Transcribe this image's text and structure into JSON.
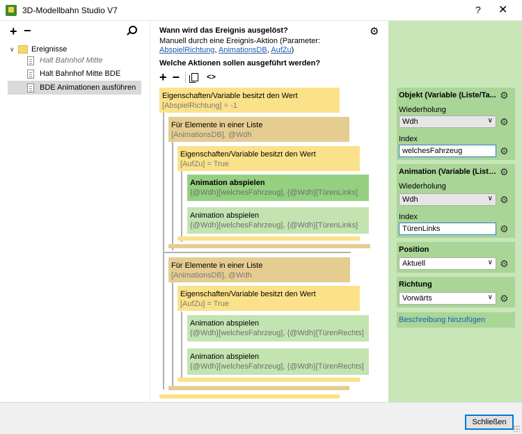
{
  "window": {
    "title": "3D-Modellbahn Studio V7",
    "help_glyph": "?",
    "close_glyph": "✕"
  },
  "left": {
    "add_glyph": "+",
    "remove_glyph": "−",
    "root": {
      "chevron": "∨",
      "label": "Ereignisse"
    },
    "items": [
      {
        "label": "Halt Bahnhof Mitte",
        "disabled": true
      },
      {
        "label": "Halt Bahnhof Mitte BDE"
      },
      {
        "label": "BDE Animationen ausführen",
        "selected": true
      }
    ]
  },
  "center": {
    "trigger_title": "Wann wird das Ereignis ausgelöst?",
    "trigger_gear": "⚙",
    "trigger_desc_prefix": "Manuell durch eine Ereignis-Aktion (Parameter: ",
    "trigger_link1": "AbspielRichtung",
    "trigger_sep1": ", ",
    "trigger_link2": "AnimationsDB",
    "trigger_sep2": ", ",
    "trigger_link3": "AufZu",
    "trigger_desc_suffix": ")",
    "actions_title": "Welche Aktionen sollen ausgeführt werden?",
    "toolbar": {
      "add": "+",
      "remove": "−",
      "code": "<>"
    },
    "blocks": {
      "b1": {
        "title": "Eigenschaften/Variable besitzt den Wert",
        "sub": "[AbspielRichtung] = -1"
      },
      "b2": {
        "title": "Für Elemente in einer Liste",
        "sub": "[AnimationsDB], @Wdh"
      },
      "b3": {
        "title": "Eigenschaften/Variable besitzt den Wert",
        "sub": "[AufZu] = True"
      },
      "b4": {
        "title": "Animation abspielen",
        "sub": "{@Wdh}[welchesFahrzeug], {@Wdh}[TürenLinks]"
      },
      "b5": {
        "title": "Animation abspielen",
        "sub": "{@Wdh}[welchesFahrzeug], {@Wdh}[TürenLinks]"
      },
      "b6": {
        "title": "Für Elemente in einer Liste",
        "sub": "[AnimationsDB], @Wdh"
      },
      "b7": {
        "title": "Eigenschaften/Variable besitzt den Wert",
        "sub": "[AufZu] = True"
      },
      "b8": {
        "title": "Animation abspielen",
        "sub": "{@Wdh}[welchesFahrzeug], {@Wdh}[TürenRechts]"
      },
      "b9": {
        "title": "Animation abspielen",
        "sub": "{@Wdh}[welchesFahrzeug], {@Wdh}[TürenRechts]"
      }
    }
  },
  "right": {
    "gear": "⚙",
    "chevron": "∨",
    "objekt": {
      "header": "Objekt (Variable (Liste/Ta...",
      "wiederholung_label": "Wiederholung",
      "wiederholung_value": "Wdh",
      "index_label": "Index",
      "index_value": "welchesFahrzeug"
    },
    "animation": {
      "header": "Animation (Variable (Liste...",
      "wiederholung_label": "Wiederholung",
      "wiederholung_value": "Wdh",
      "index_label": "Index",
      "index_value": "TürenLinks"
    },
    "position": {
      "header": "Position",
      "value": "Aktuell"
    },
    "richtung": {
      "header": "Richtung",
      "value": "Vorwärts"
    },
    "beschreibung_link": "Beschreibung hinzufügen"
  },
  "footer": {
    "close_label": "Schließen"
  },
  "colors": {
    "yellow": "#fbe28a",
    "tan": "#e5cd92",
    "green": "#94d080",
    "light_green": "#c3e4b1",
    "panel_green": "#c8e6b8",
    "group_green": "#a9d597",
    "link_blue": "#1a5fb4"
  }
}
